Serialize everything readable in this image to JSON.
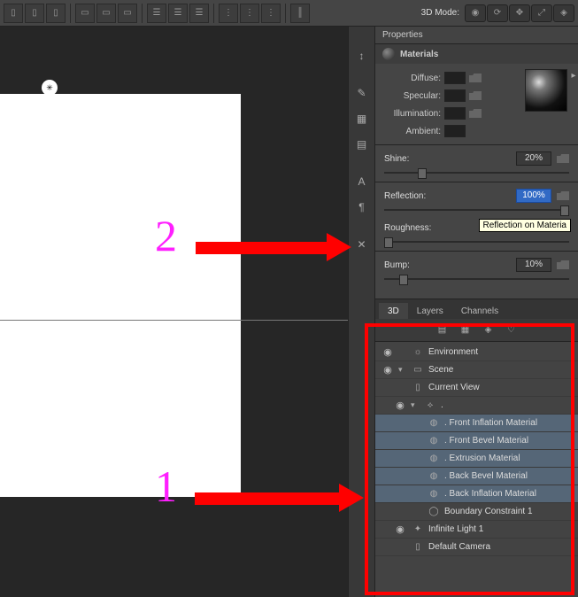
{
  "toolbar": {
    "mode_label": "3D Mode:"
  },
  "panels": {
    "properties_title": "Properties",
    "materials_title": "Materials"
  },
  "material": {
    "diffuse_label": "Diffuse:",
    "specular_label": "Specular:",
    "illumination_label": "Illumination:",
    "ambient_label": "Ambient:"
  },
  "sliders": {
    "shine": {
      "label": "Shine:",
      "value": "20%",
      "pos": 20
    },
    "reflection": {
      "label": "Reflection:",
      "value": "100%",
      "pos": 100,
      "tooltip": "Reflection on Materia"
    },
    "roughness": {
      "label": "Roughness:",
      "value": "",
      "pos": 0
    },
    "bump": {
      "label": "Bump:",
      "value": "10%",
      "pos": 10
    }
  },
  "panel3d": {
    "tabs": {
      "t3d": "3D",
      "layers": "Layers",
      "channels": "Channels"
    },
    "items": {
      "environment": "Environment",
      "scene": "Scene",
      "current_view": "Current View",
      "dot": ".",
      "m0": ". Front Inflation Material",
      "m1": ". Front Bevel Material",
      "m2": ". Extrusion Material",
      "m3": ". Back Bevel Material",
      "m4": ". Back Inflation Material",
      "bc": "Boundary Constraint 1",
      "light": "Infinite Light 1",
      "camera": "Default Camera"
    }
  },
  "annotations": {
    "n1": "1",
    "n2": "2"
  }
}
